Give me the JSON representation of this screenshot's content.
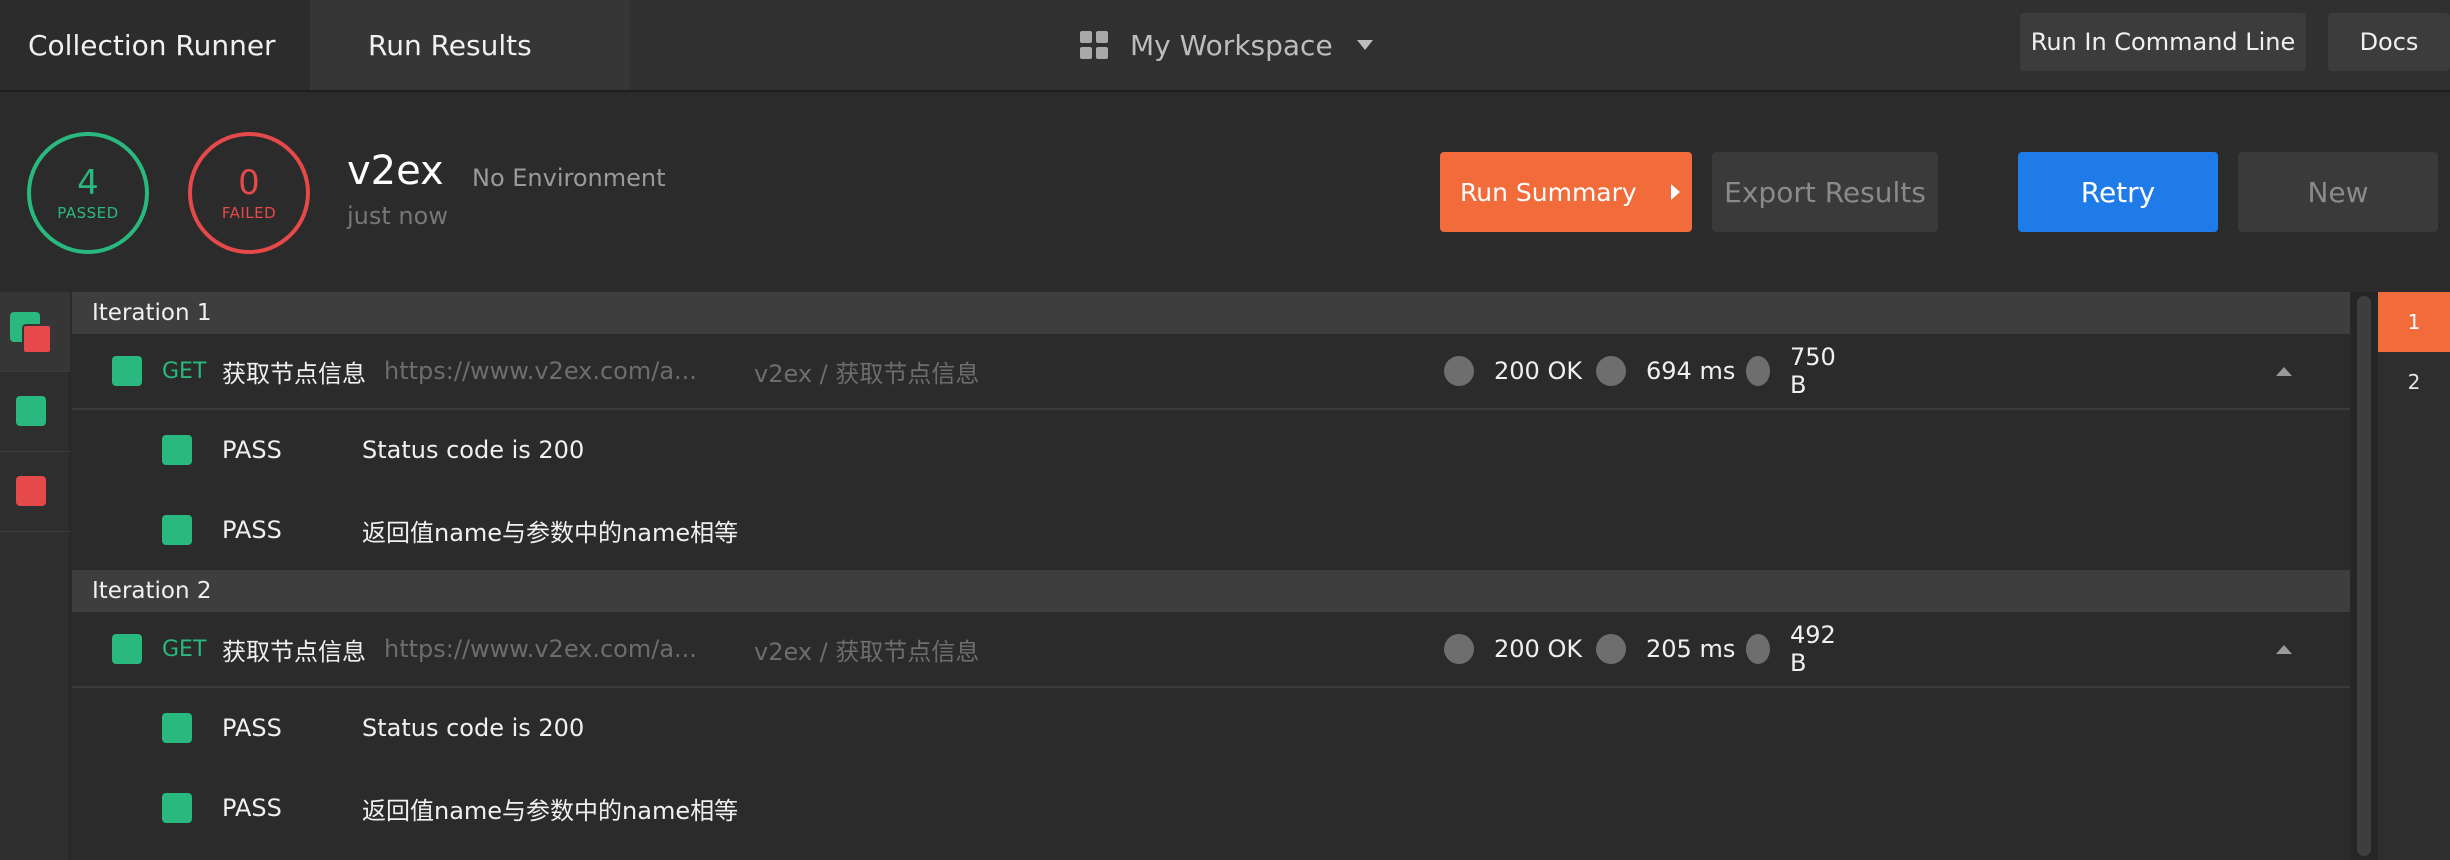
{
  "nav": {
    "crumbs": [
      "Collection Runner",
      "Run Results"
    ],
    "workspace": "My Workspace",
    "btn_command_line": "Run In Command Line",
    "btn_docs": "Docs"
  },
  "summary": {
    "passed_count": "4",
    "passed_label": "PASSED",
    "failed_count": "0",
    "failed_label": "FAILED",
    "collection_name": "v2ex",
    "environment": "No Environment",
    "run_time": "just now",
    "btn_run_summary": "Run Summary",
    "btn_export": "Export Results",
    "btn_retry": "Retry",
    "btn_new": "New"
  },
  "colors": {
    "pass": "#29b97f",
    "fail": "#e5494a",
    "accent_orange": "#f26b3a",
    "accent_blue": "#1f7be8"
  },
  "iterations": [
    {
      "label": "Iteration 1",
      "request": {
        "method": "GET",
        "name": "获取节点信息",
        "url": "https://www.v2ex.com/a...",
        "path": "v2ex / 获取节点信息",
        "status": "200 OK",
        "time": "694 ms",
        "size": "750 B"
      },
      "tests": [
        {
          "status": "PASS",
          "name": "Status code is 200"
        },
        {
          "status": "PASS",
          "name": "返回值name与参数中的name相等"
        }
      ]
    },
    {
      "label": "Iteration 2",
      "request": {
        "method": "GET",
        "name": "获取节点信息",
        "url": "https://www.v2ex.com/a...",
        "path": "v2ex / 获取节点信息",
        "status": "200 OK",
        "time": "205 ms",
        "size": "492 B"
      },
      "tests": [
        {
          "status": "PASS",
          "name": "Status code is 200"
        },
        {
          "status": "PASS",
          "name": "返回值name与参数中的name相等"
        }
      ]
    }
  ],
  "pager": [
    "1",
    "2"
  ]
}
